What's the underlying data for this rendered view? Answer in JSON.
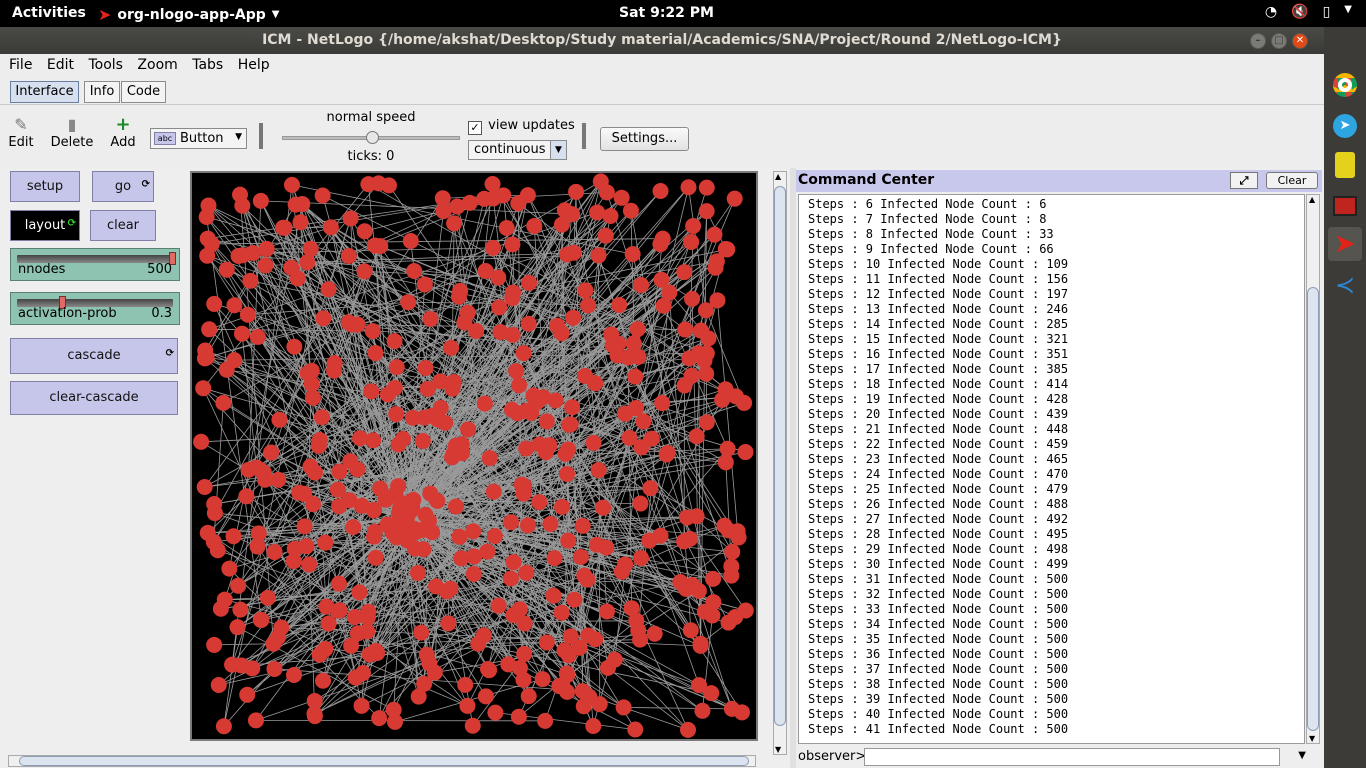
{
  "topbar": {
    "activities": "Activities",
    "app": "org-nlogo-app-App",
    "clock": "Sat  9:22 PM"
  },
  "window": {
    "title": "ICM - NetLogo {/home/akshat/Desktop/Study material/Academics/SNA/Project/Round 2/NetLogo-ICM}"
  },
  "menu": [
    "File",
    "Edit",
    "Tools",
    "Zoom",
    "Tabs",
    "Help"
  ],
  "tabs": [
    "Interface",
    "Info",
    "Code"
  ],
  "toolbar": {
    "edit": "Edit",
    "delete": "Delete",
    "add": "Add",
    "widget_type": "Button",
    "speed_label": "normal speed",
    "ticks_label": "ticks: 0",
    "view_updates": "view updates",
    "update_mode": "continuous",
    "settings": "Settings..."
  },
  "widgets": {
    "setup": "setup",
    "go": "go",
    "layout": "layout",
    "clear": "clear",
    "nnodes": {
      "label": "nnodes",
      "value": "500"
    },
    "activation_prob": {
      "label": "activation-prob",
      "value": "0.3"
    },
    "cascade": "cascade",
    "clear_cascade": "clear-cascade"
  },
  "command_center": {
    "title": "Command Center",
    "clear": "Clear",
    "prompt": "observer>",
    "lines": [
      "Steps : 6 Infected Node Count : 6",
      "Steps : 7 Infected Node Count : 8",
      "Steps : 8 Infected Node Count : 33",
      "Steps : 9 Infected Node Count : 66",
      "Steps : 10 Infected Node Count : 109",
      "Steps : 11 Infected Node Count : 156",
      "Steps : 12 Infected Node Count : 197",
      "Steps : 13 Infected Node Count : 246",
      "Steps : 14 Infected Node Count : 285",
      "Steps : 15 Infected Node Count : 321",
      "Steps : 16 Infected Node Count : 351",
      "Steps : 17 Infected Node Count : 385",
      "Steps : 18 Infected Node Count : 414",
      "Steps : 19 Infected Node Count : 428",
      "Steps : 20 Infected Node Count : 439",
      "Steps : 21 Infected Node Count : 448",
      "Steps : 22 Infected Node Count : 459",
      "Steps : 23 Infected Node Count : 465",
      "Steps : 24 Infected Node Count : 470",
      "Steps : 25 Infected Node Count : 479",
      "Steps : 26 Infected Node Count : 488",
      "Steps : 27 Infected Node Count : 492",
      "Steps : 28 Infected Node Count : 495",
      "Steps : 29 Infected Node Count : 498",
      "Steps : 30 Infected Node Count : 499",
      "Steps : 31 Infected Node Count : 500",
      "Steps : 32 Infected Node Count : 500",
      "Steps : 33 Infected Node Count : 500",
      "Steps : 34 Infected Node Count : 500",
      "Steps : 35 Infected Node Count : 500",
      "Steps : 36 Infected Node Count : 500",
      "Steps : 37 Infected Node Count : 500",
      "Steps : 38 Infected Node Count : 500",
      "Steps : 39 Infected Node Count : 500",
      "Steps : 40 Infected Node Count : 500",
      "Steps : 41 Infected Node Count : 500"
    ]
  },
  "colors": {
    "node": "#d73a33",
    "link": "#9a9a9a",
    "button": "#c6c6ea",
    "slider": "#8dc3b0"
  },
  "view": {
    "node_count": 500
  }
}
